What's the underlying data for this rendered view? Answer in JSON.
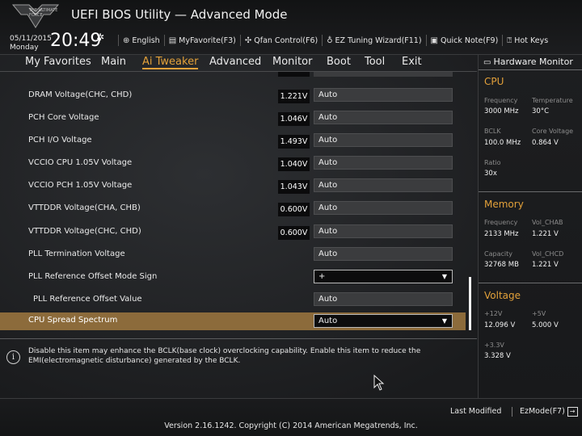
{
  "header": {
    "logo_text": "THE ULTIMATE FORCE",
    "title": "UEFI BIOS Utility — Advanced Mode",
    "date": "05/11/2015",
    "day": "Monday",
    "time": "20:49",
    "tools": [
      {
        "icon": "globe-icon",
        "label": "English"
      },
      {
        "icon": "favorite-icon",
        "label": "MyFavorite(F3)"
      },
      {
        "icon": "fan-icon",
        "label": "Qfan Control(F6)"
      },
      {
        "icon": "bulb-icon",
        "label": "EZ Tuning Wizard(F11)"
      },
      {
        "icon": "note-icon",
        "label": "Quick Note(F9)"
      },
      {
        "icon": "help-icon",
        "label": "Hot Keys"
      }
    ]
  },
  "nav": {
    "tabs": [
      "My Favorites",
      "Main",
      "Ai Tweaker",
      "Advanced",
      "Monitor",
      "Boot",
      "Tool",
      "Exit"
    ],
    "active": "Ai Tweaker"
  },
  "settings": [
    {
      "label": "DRAM Voltage(CHC, CHD)",
      "current": "1.221V",
      "value": "Auto"
    },
    {
      "label": "PCH Core Voltage",
      "current": "1.046V",
      "value": "Auto"
    },
    {
      "label": "PCH I/O Voltage",
      "current": "1.493V",
      "value": "Auto"
    },
    {
      "label": "VCCIO CPU 1.05V Voltage",
      "current": "1.040V",
      "value": "Auto"
    },
    {
      "label": "VCCIO PCH 1.05V Voltage",
      "current": "1.043V",
      "value": "Auto"
    },
    {
      "label": "VTTDDR Voltage(CHA, CHB)",
      "current": "0.600V",
      "value": "Auto"
    },
    {
      "label": "VTTDDR Voltage(CHC, CHD)",
      "current": "0.600V",
      "value": "Auto"
    },
    {
      "label": "PLL Termination Voltage",
      "current": "",
      "value": "Auto"
    },
    {
      "label": "PLL Reference Offset Mode Sign",
      "current": "",
      "value": "+"
    },
    {
      "label": "PLL Reference Offset Value",
      "current": "",
      "value": "Auto"
    },
    {
      "label": "CPU Spread Spectrum",
      "current": "",
      "value": "Auto"
    }
  ],
  "help": {
    "text": "Disable this item may enhance the BCLK(base clock) overclocking capability. Enable this item to reduce the EMI(electromagnetic disturbance) generated by the BCLK."
  },
  "hardware_monitor": {
    "title": "Hardware Monitor",
    "cpu": {
      "heading": "CPU",
      "frequency_label": "Frequency",
      "frequency": "3000 MHz",
      "temperature_label": "Temperature",
      "temperature": "30°C",
      "bclk_label": "BCLK",
      "bclk": "100.0 MHz",
      "core_voltage_label": "Core Voltage",
      "core_voltage": "0.864 V",
      "ratio_label": "Ratio",
      "ratio": "30x"
    },
    "memory": {
      "heading": "Memory",
      "frequency_label": "Frequency",
      "frequency": "2133 MHz",
      "vol_chab_label": "Vol_CHAB",
      "vol_chab": "1.221 V",
      "capacity_label": "Capacity",
      "capacity": "32768 MB",
      "vol_chcd_label": "Vol_CHCD",
      "vol_chcd": "1.221 V"
    },
    "voltage": {
      "heading": "Voltage",
      "v12_label": "+12V",
      "v12": "12.096 V",
      "v5_label": "+5V",
      "v5": "5.000 V",
      "v33_label": "+3.3V",
      "v33": "3.328 V"
    }
  },
  "footer": {
    "last_modified": "Last Modified",
    "ezmode": "EzMode(F7)",
    "version": "Version 2.16.1242. Copyright (C) 2014 American Megatrends, Inc."
  }
}
